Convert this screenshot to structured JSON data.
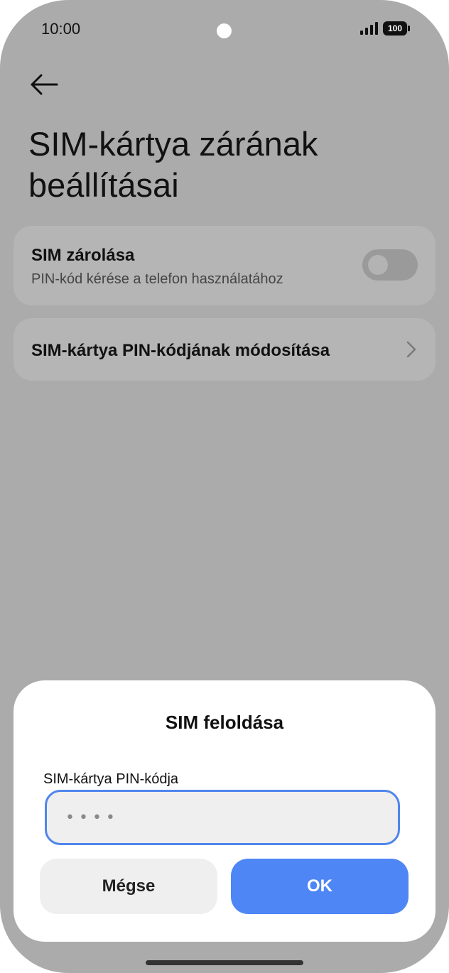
{
  "status_bar": {
    "time": "10:00",
    "battery": "100",
    "icons": [
      "camera-dot",
      "signal-icon",
      "battery-icon"
    ]
  },
  "header": {
    "back_icon": "arrow-left-icon",
    "title": "SIM-kártya zárának beállításai"
  },
  "settings": {
    "sim_lock": {
      "title": "SIM zárolása",
      "subtitle": "PIN-kód kérése a telefon használatához",
      "toggle_on": false
    },
    "change_pin": {
      "title": "SIM-kártya PIN-kódjának módosítása",
      "icon": "chevron-right-icon"
    }
  },
  "dialog": {
    "title": "SIM feloldása",
    "pin_label": "SIM-kártya PIN-kódja",
    "pin_value": "••••",
    "cancel_label": "Mégse",
    "ok_label": "OK"
  },
  "colors": {
    "screen_background": "#ababab",
    "card_background": "#b5b5b5",
    "dialog_background": "#ffffff",
    "accent": "#4f86f6",
    "input_border": "#4f86ec",
    "cancel_button": "#efefef"
  }
}
